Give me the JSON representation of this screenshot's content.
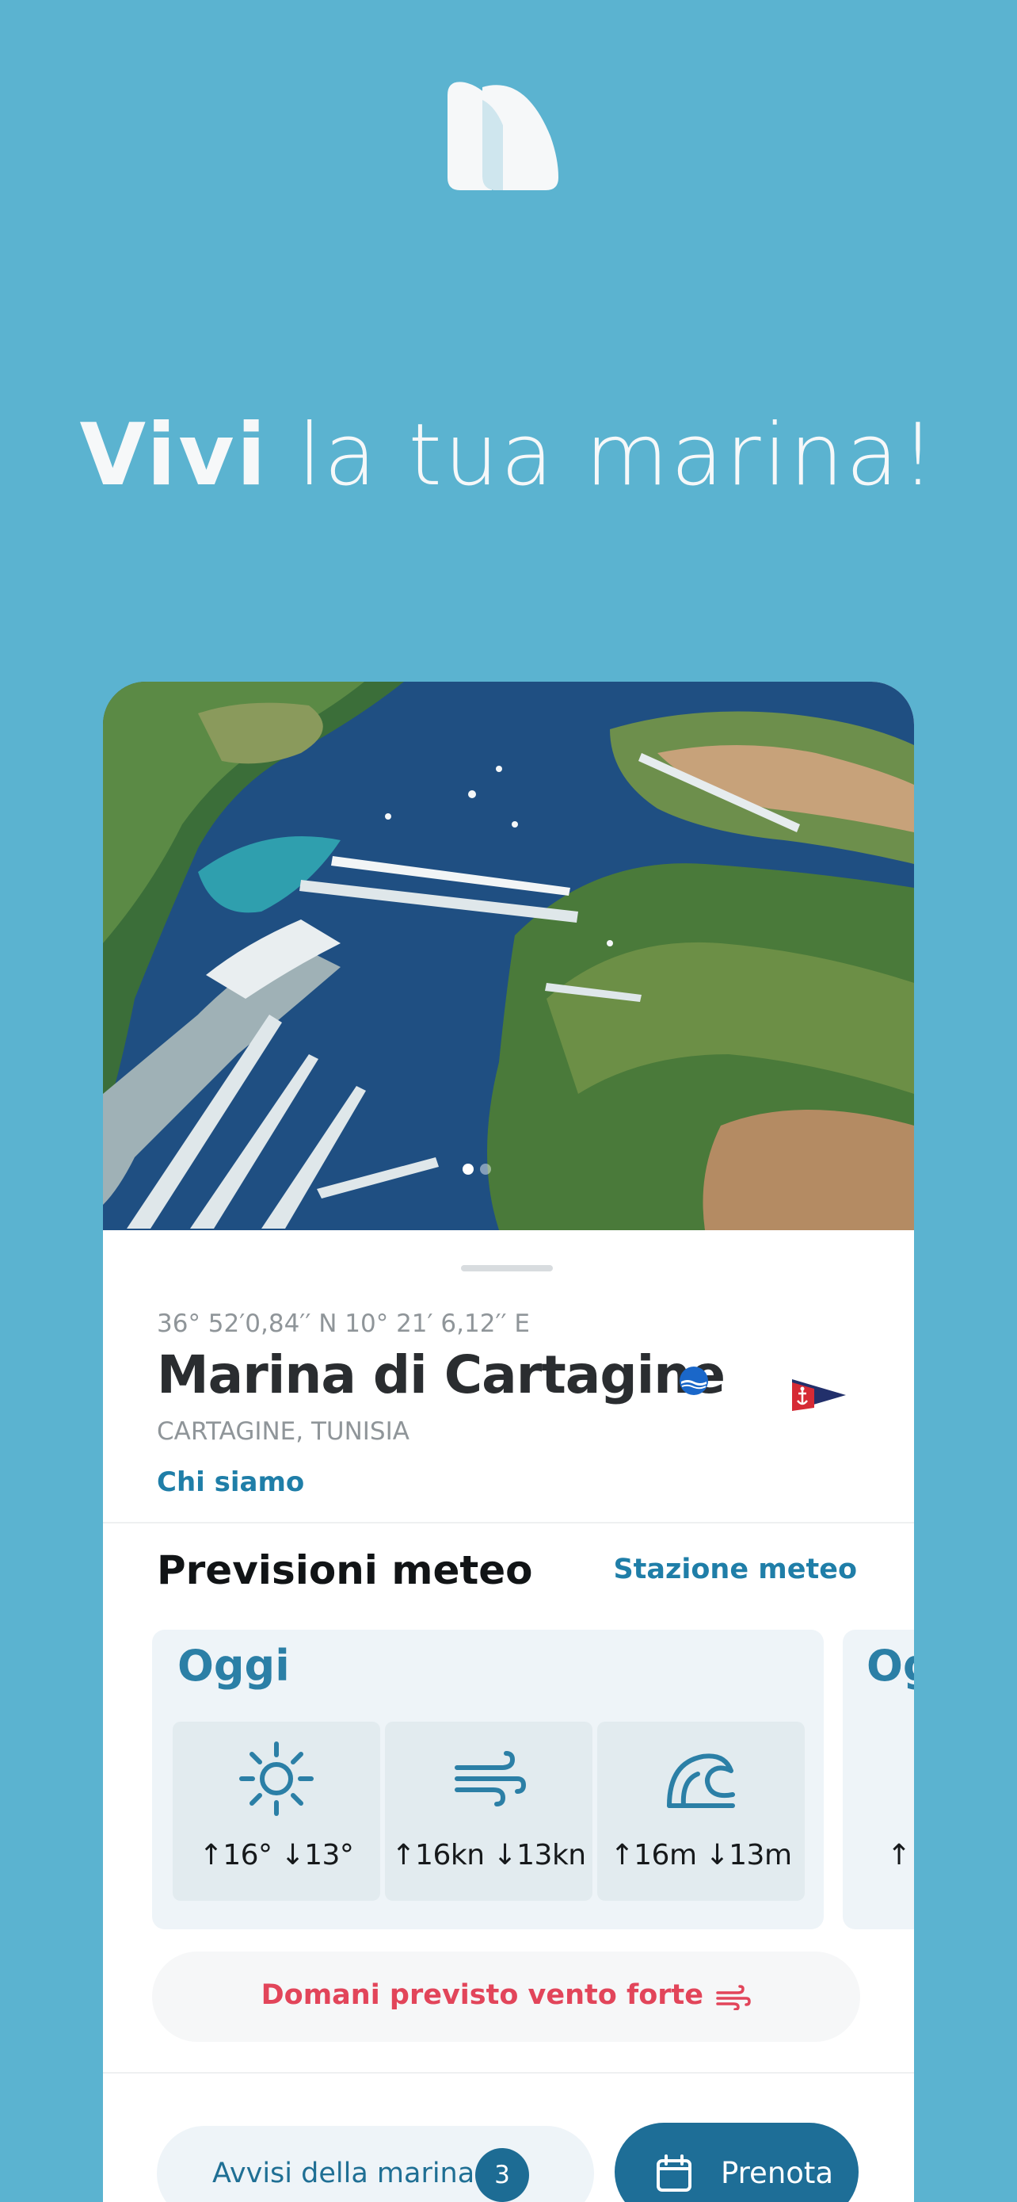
{
  "headline": {
    "bold": "Vivi",
    "rest": " la tua marina!"
  },
  "marina": {
    "coordinates": "36° 52′0,84′′ N 10° 21′ 6,12′′ E",
    "name": "Marina di Cartagine",
    "location": "CARTAGINE, TUNISIA",
    "about_link": "Chi siamo"
  },
  "carousel": {
    "page_count": 2,
    "active_page": 1
  },
  "weather": {
    "title": "Previsioni meteo",
    "station_link": "Stazione meteo",
    "today": {
      "label": "Oggi",
      "temperature": "↑16°  ↓13°",
      "wind": "↑16kn ↓13kn",
      "waves": "↑16m ↓13m"
    },
    "next": {
      "label": "Oggi",
      "value": "↑"
    },
    "alert": "Domani previsto vento forte"
  },
  "actions": {
    "notices_label": "Avvisi della marina",
    "notices_count": "3",
    "book_label": "Prenota"
  },
  "colors": {
    "background": "#5bb3d0",
    "accent": "#1f7ea8",
    "primary_button": "#1e6e97",
    "alert": "#e2455a"
  },
  "icons": {
    "logo": "sail-logo",
    "temperature": "sun-icon",
    "wind": "wind-icon",
    "waves": "wave-icon",
    "alert": "wind-alert-icon",
    "book": "calendar-icon"
  }
}
